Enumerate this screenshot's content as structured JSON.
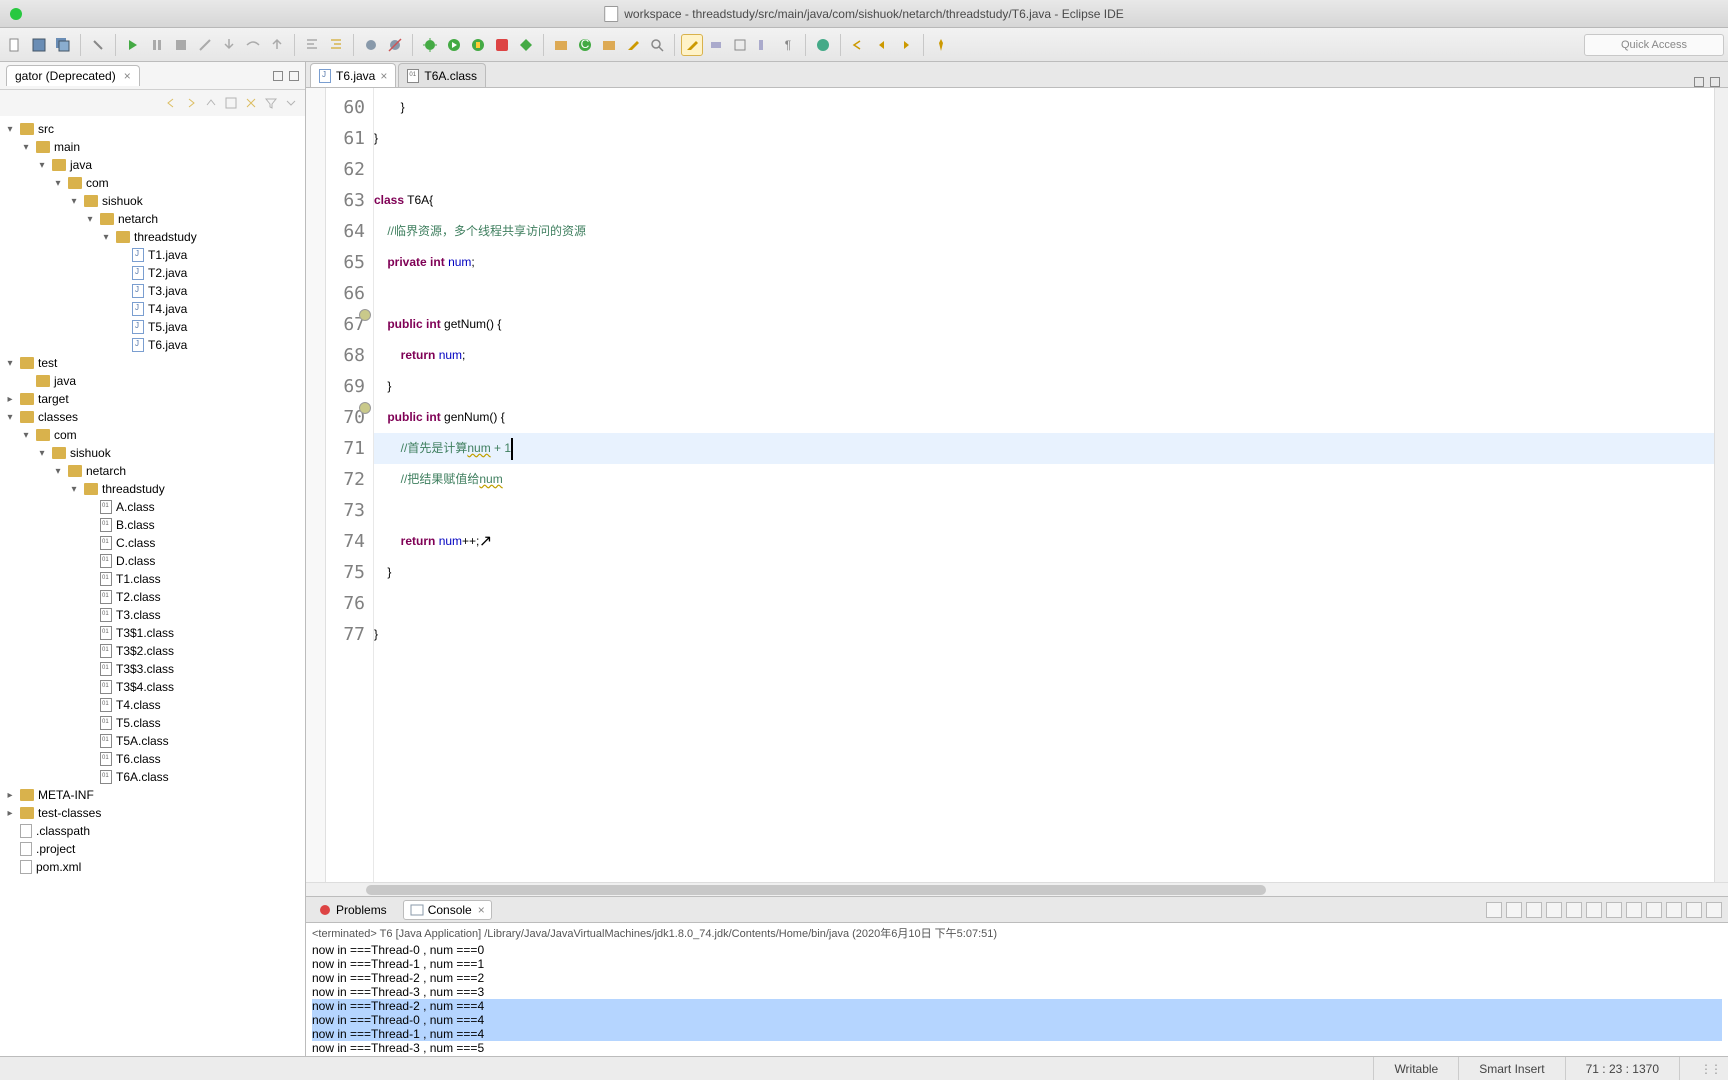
{
  "window": {
    "title": "workspace - threadstudy/src/main/java/com/sishuok/netarch/threadstudy/T6.java - Eclipse IDE"
  },
  "quick_access_placeholder": "Quick Access",
  "navigator": {
    "tab_label": "gator (Deprecated)",
    "tree": [
      {
        "d": 0,
        "t": "src",
        "k": "folder",
        "tw": "▾"
      },
      {
        "d": 1,
        "t": "main",
        "k": "folder",
        "tw": "▾"
      },
      {
        "d": 2,
        "t": "java",
        "k": "folder",
        "tw": "▾"
      },
      {
        "d": 3,
        "t": "com",
        "k": "folder",
        "tw": "▾"
      },
      {
        "d": 4,
        "t": "sishuok",
        "k": "folder",
        "tw": "▾"
      },
      {
        "d": 5,
        "t": "netarch",
        "k": "folder",
        "tw": "▾"
      },
      {
        "d": 6,
        "t": "threadstudy",
        "k": "folder",
        "tw": "▾"
      },
      {
        "d": 7,
        "t": "T1.java",
        "k": "java"
      },
      {
        "d": 7,
        "t": "T2.java",
        "k": "java"
      },
      {
        "d": 7,
        "t": "T3.java",
        "k": "java"
      },
      {
        "d": 7,
        "t": "T4.java",
        "k": "java"
      },
      {
        "d": 7,
        "t": "T5.java",
        "k": "java"
      },
      {
        "d": 7,
        "t": "T6.java",
        "k": "java"
      },
      {
        "d": 0,
        "t": "test",
        "k": "folder",
        "tw": "▾"
      },
      {
        "d": 1,
        "t": "java",
        "k": "folder"
      },
      {
        "d": 0,
        "t": "target",
        "k": "folder",
        "tw": "▸"
      },
      {
        "d": 0,
        "t": "classes",
        "k": "folder",
        "tw": "▾"
      },
      {
        "d": 1,
        "t": "com",
        "k": "folder",
        "tw": "▾"
      },
      {
        "d": 2,
        "t": "sishuok",
        "k": "folder",
        "tw": "▾"
      },
      {
        "d": 3,
        "t": "netarch",
        "k": "folder",
        "tw": "▾"
      },
      {
        "d": 4,
        "t": "threadstudy",
        "k": "folder",
        "tw": "▾"
      },
      {
        "d": 5,
        "t": "A.class",
        "k": "class"
      },
      {
        "d": 5,
        "t": "B.class",
        "k": "class"
      },
      {
        "d": 5,
        "t": "C.class",
        "k": "class"
      },
      {
        "d": 5,
        "t": "D.class",
        "k": "class"
      },
      {
        "d": 5,
        "t": "T1.class",
        "k": "class"
      },
      {
        "d": 5,
        "t": "T2.class",
        "k": "class"
      },
      {
        "d": 5,
        "t": "T3.class",
        "k": "class"
      },
      {
        "d": 5,
        "t": "T3$1.class",
        "k": "class"
      },
      {
        "d": 5,
        "t": "T3$2.class",
        "k": "class"
      },
      {
        "d": 5,
        "t": "T3$3.class",
        "k": "class"
      },
      {
        "d": 5,
        "t": "T3$4.class",
        "k": "class"
      },
      {
        "d": 5,
        "t": "T4.class",
        "k": "class"
      },
      {
        "d": 5,
        "t": "T5.class",
        "k": "class"
      },
      {
        "d": 5,
        "t": "T5A.class",
        "k": "class"
      },
      {
        "d": 5,
        "t": "T6.class",
        "k": "class"
      },
      {
        "d": 5,
        "t": "T6A.class",
        "k": "class"
      },
      {
        "d": 0,
        "t": "META-INF",
        "k": "folder",
        "tw": "▸"
      },
      {
        "d": 0,
        "t": "test-classes",
        "k": "folder",
        "tw": "▸"
      },
      {
        "d": 0,
        "t": ".classpath",
        "k": "file"
      },
      {
        "d": 0,
        "t": ".project",
        "k": "file"
      },
      {
        "d": 0,
        "t": "pom.xml",
        "k": "file"
      }
    ]
  },
  "editor": {
    "tabs": [
      {
        "label": "T6.java",
        "active": true,
        "closable": true
      },
      {
        "label": "T6A.class",
        "active": false,
        "closable": false
      }
    ],
    "lines": [
      {
        "n": 60,
        "segs": [
          {
            "t": "        }"
          }
        ]
      },
      {
        "n": 61,
        "segs": [
          {
            "t": "}"
          }
        ]
      },
      {
        "n": 62,
        "segs": [
          {
            "t": ""
          }
        ]
      },
      {
        "n": 63,
        "segs": [
          {
            "t": "class",
            "c": "kw"
          },
          {
            "t": " T6A{"
          }
        ]
      },
      {
        "n": 64,
        "segs": [
          {
            "t": "    "
          },
          {
            "t": "//临界资源，多个线程共享访问的资源",
            "c": "cm"
          }
        ]
      },
      {
        "n": 65,
        "segs": [
          {
            "t": "    "
          },
          {
            "t": "private",
            "c": "kw"
          },
          {
            "t": " "
          },
          {
            "t": "int",
            "c": "kw"
          },
          {
            "t": " "
          },
          {
            "t": "num",
            "c": "fld-name"
          },
          {
            "t": ";"
          }
        ]
      },
      {
        "n": 66,
        "segs": [
          {
            "t": ""
          }
        ]
      },
      {
        "n": 67,
        "m": true,
        "segs": [
          {
            "t": "    "
          },
          {
            "t": "public",
            "c": "kw"
          },
          {
            "t": " "
          },
          {
            "t": "int",
            "c": "kw"
          },
          {
            "t": " getNum() {"
          }
        ]
      },
      {
        "n": 68,
        "segs": [
          {
            "t": "        "
          },
          {
            "t": "return",
            "c": "kw"
          },
          {
            "t": " "
          },
          {
            "t": "num",
            "c": "fld-name"
          },
          {
            "t": ";"
          }
        ]
      },
      {
        "n": 69,
        "segs": [
          {
            "t": "    }"
          }
        ]
      },
      {
        "n": 70,
        "m": true,
        "segs": [
          {
            "t": "    "
          },
          {
            "t": "public",
            "c": "kw"
          },
          {
            "t": " "
          },
          {
            "t": "int",
            "c": "kw"
          },
          {
            "t": " genNum() {"
          }
        ]
      },
      {
        "n": 71,
        "hl": true,
        "segs": [
          {
            "t": "        "
          },
          {
            "t": "//首先是计算",
            "c": "cm"
          },
          {
            "t": "num",
            "c": "cm squig"
          },
          {
            "t": " + 1",
            "c": "cm"
          },
          {
            "caret": true
          }
        ]
      },
      {
        "n": 72,
        "segs": [
          {
            "t": "        "
          },
          {
            "t": "//把结果赋值给",
            "c": "cm"
          },
          {
            "t": "num",
            "c": "cm squig"
          }
        ]
      },
      {
        "n": 73,
        "segs": [
          {
            "t": ""
          }
        ]
      },
      {
        "n": 74,
        "segs": [
          {
            "t": "        "
          },
          {
            "t": "return",
            "c": "kw"
          },
          {
            "t": " "
          },
          {
            "t": "num",
            "c": "fld-name"
          },
          {
            "t": "++;"
          }
        ],
        "ptr": true
      },
      {
        "n": 75,
        "segs": [
          {
            "t": "    }"
          }
        ]
      },
      {
        "n": 76,
        "segs": [
          {
            "t": ""
          }
        ]
      },
      {
        "n": 77,
        "segs": [
          {
            "t": "}"
          }
        ]
      }
    ]
  },
  "bottom": {
    "tabs": {
      "problems": "Problems",
      "console": "Console"
    },
    "console_header": "<terminated> T6 [Java Application] /Library/Java/JavaVirtualMachines/jdk1.8.0_74.jdk/Contents/Home/bin/java (2020年6月10日 下午5:07:51)",
    "console_lines": [
      {
        "t": "now in ===Thread-0 , num ===0"
      },
      {
        "t": "now in ===Thread-1 , num ===1"
      },
      {
        "t": "now in ===Thread-2 , num ===2"
      },
      {
        "t": "now in ===Thread-3 , num ===3"
      },
      {
        "t": "now in ===Thread-2 , num ===4",
        "sel": true
      },
      {
        "t": "now in ===Thread-0 , num ===4",
        "sel": true
      },
      {
        "t": "now in ===Thread-1 , num ===4",
        "sel": true
      },
      {
        "t": "now in ===Thread-3 , num ===5"
      }
    ]
  },
  "status": {
    "writable": "Writable",
    "insert": "Smart Insert",
    "position": "71 : 23 : 1370"
  }
}
